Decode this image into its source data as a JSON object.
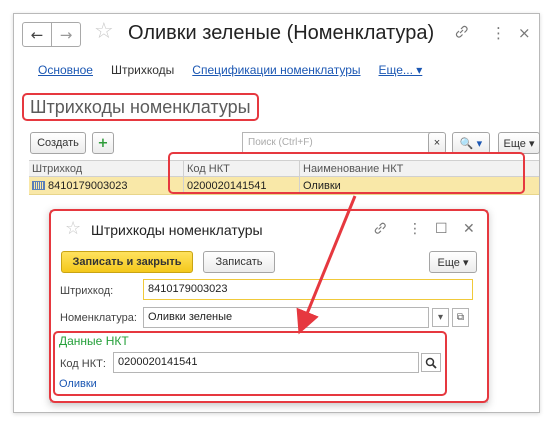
{
  "window": {
    "title": "Оливки зеленые (Номенклатура)",
    "back_glyph": "←",
    "forward_glyph": "→",
    "star_glyph": "☆",
    "link_glyph": "🔗",
    "more_glyph": "⋮",
    "close_glyph": "×"
  },
  "tabs": [
    {
      "label": "Основное"
    },
    {
      "label": "Штрихкоды"
    },
    {
      "label": "Спецификации номенклатуры"
    },
    {
      "label": "Еще... ▾"
    }
  ],
  "section_title": "Штрихкоды номенклатуры",
  "toolbar": {
    "create_label": "Создать",
    "add_glyph": "+",
    "search_placeholder": "Поиск (Ctrl+F)",
    "clear_glyph": "×",
    "search_glyph": "🔍 ▾",
    "more_label": "Еще ▾"
  },
  "grid": {
    "headers": [
      "Штрихкод",
      "Код НКТ",
      "Наименование НКТ"
    ],
    "rows": [
      [
        "8410179003023",
        "0200020141541",
        "Оливки"
      ]
    ]
  },
  "dialog": {
    "title": "Штрихкоды номенклатуры",
    "link_glyph": "🔗",
    "more_glyph": "⋮",
    "maximize_glyph": "☐",
    "close_glyph": "✕",
    "save_close_label": "Записать и закрыть",
    "save_label": "Записать",
    "more_label": "Еще ▾",
    "barcode_label": "Штрихкод:",
    "barcode_value": "8410179003023",
    "nomenclature_label": "Номенклатура:",
    "nomenclature_value": "Оливки зеленые",
    "dropdown_glyph": "▾",
    "open_glyph": "⧉",
    "nkt_group_title": "Данные НКТ",
    "nkt_code_label": "Код НКТ:",
    "nkt_code_value": "0200020141541",
    "nkt_search_glyph": "🔍",
    "nkt_name": "Оливки"
  },
  "colors": {
    "highlight_red": "#e6383f",
    "selected_row": "#f9e8a8",
    "primary_button": "#f4c81b",
    "link_blue": "#1b57b3",
    "group_green": "#25a03a"
  }
}
